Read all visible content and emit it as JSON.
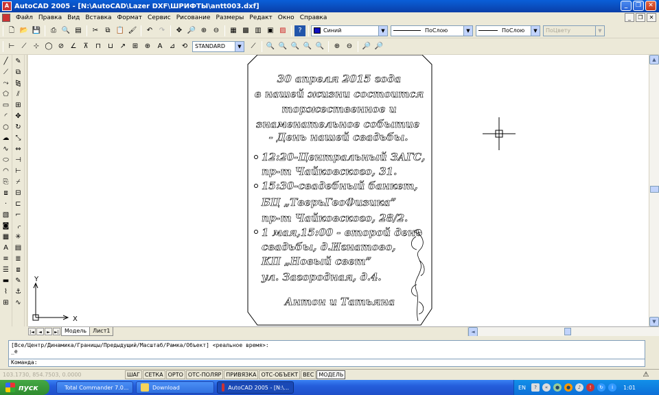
{
  "titlebar": {
    "title": "AutoCAD 2005 - [N:\\AutoCAD\\Lazer DXF\\ШРИФТЫ\\antt003.dxf]",
    "minimize": "_",
    "restore": "❐",
    "close": "✕"
  },
  "menu": {
    "items": [
      "Файл",
      "Правка",
      "Вид",
      "Вставка",
      "Формат",
      "Сервис",
      "Рисование",
      "Размеры",
      "Редакт",
      "Окно",
      "Справка"
    ],
    "doc_minimize": "_",
    "doc_restore": "❐",
    "doc_close": "✕"
  },
  "properties_toolbar": {
    "color": "Синий",
    "color_swatch": "#1010c0",
    "linetype": "ПоСлою",
    "lineweight": "ПоСлою",
    "plotstyle": "ПоЦвету"
  },
  "styles_toolbar": {
    "dimstyle": "STANDARD"
  },
  "drawing": {
    "lines": [
      "30 апреля 2015 года",
      "в нашей жизни состоится",
      "торжественное и",
      "знаменательное событие",
      "- День нашей свадьбы.",
      "12:20-Центральный ЗАГС,",
      "пр-т Чайковского, 31.",
      "15:30-свадебный банкет,",
      "БЦ „ТверьГеоФизика”",
      "пр-т Чайковского, 28/2.",
      "1 мая,15:00 - второй день",
      "свадьбы, д.Игнатово,",
      "КП „Новый свет”",
      "ул. Загородная, д.4.",
      "Антон и Татьяна"
    ],
    "ucs_x": "X",
    "ucs_y": "Y"
  },
  "layout_tabs": {
    "nav": [
      "|◄",
      "◄",
      "►",
      "►|"
    ],
    "tabs": [
      "Модель",
      "Лист1"
    ]
  },
  "command": {
    "history": "[Все/Центр/Динамика/Границы/Предыдущий/Масштаб/Рамка/Объект] <реальное время>:",
    "history2": "_e",
    "prompt": "Команда:"
  },
  "statusbar": {
    "coords": "103.1730, 854.7503, 0.0000",
    "buttons": [
      {
        "label": "ШАГ",
        "on": false
      },
      {
        "label": "СЕТКА",
        "on": false
      },
      {
        "label": "ОРТО",
        "on": false
      },
      {
        "label": "ОТС-ПОЛЯР",
        "on": false
      },
      {
        "label": "ПРИВЯЗКА",
        "on": false
      },
      {
        "label": "ОТС-ОБЪЕКТ",
        "on": false
      },
      {
        "label": "ВЕС",
        "on": false
      },
      {
        "label": "МОДЕЛЬ",
        "on": true
      }
    ]
  },
  "taskbar": {
    "start": "пуск",
    "tasks": [
      {
        "label": "Total Commander 7.0...",
        "color": "#f2c200"
      },
      {
        "label": "Download",
        "color": "#f5d35a"
      },
      {
        "label": "AutoCAD 2005 - [N:\\...",
        "color": "#c33"
      }
    ],
    "lang": "EN",
    "clock": "1:01"
  }
}
